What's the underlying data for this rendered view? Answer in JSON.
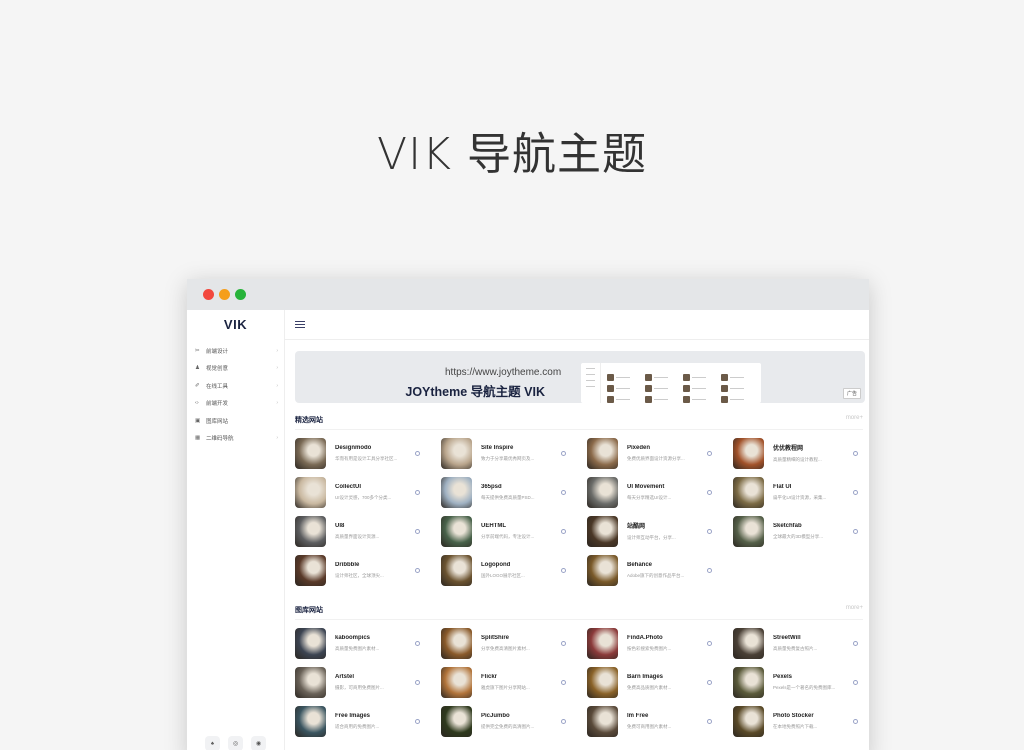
{
  "headline": "VIK 导航主题",
  "window": {
    "brand": "VIK",
    "sidebar": {
      "items": [
        {
          "icon": "✂",
          "icon_name": "scissors-icon",
          "label": "前端设计"
        },
        {
          "icon": "♟",
          "icon_name": "pin-icon",
          "label": "视觉创意"
        },
        {
          "icon": "✐",
          "icon_name": "pen-icon",
          "label": "在线工具"
        },
        {
          "icon": "‹›",
          "icon_name": "code-icon",
          "label": "前端开发"
        },
        {
          "icon": "▣",
          "icon_name": "image-icon",
          "label": "图库网站"
        },
        {
          "icon": "▦",
          "icon_name": "qrcode-icon",
          "label": "二维码导航"
        }
      ],
      "chevron": "›",
      "footer_buttons": [
        {
          "icon": "♠",
          "icon_name": "qq-icon"
        },
        {
          "icon": "◎",
          "icon_name": "weibo-icon"
        },
        {
          "icon": "◉",
          "icon_name": "wechat-icon"
        }
      ]
    },
    "banner": {
      "url": "https://www.joytheme.com",
      "title": "JOYtheme 导航主题 VIK",
      "ad_label": "广告"
    },
    "sections": [
      {
        "title": "精选网站",
        "more": "more+",
        "cards": [
          {
            "name": "Designmodo",
            "desc": "华而有用是设计工具分享社区...",
            "color": "#7a6a55"
          },
          {
            "name": "Site Inspire",
            "desc": "致力于分享最优秀网页及...",
            "color": "#b9a58c"
          },
          {
            "name": "Pixeden",
            "desc": "免费优质界面设计资源分享...",
            "color": "#8b6a4a"
          },
          {
            "name": "优优教程网",
            "desc": "高质量精细的设计教程...",
            "color": "#a2522a"
          },
          {
            "name": "CollectUI",
            "desc": "UI设计灵感，700多个分类...",
            "color": "#c9b8a0"
          },
          {
            "name": "365psd",
            "desc": "每天提供免费高质量PSD...",
            "color": "#9fb1c2"
          },
          {
            "name": "UI Movement",
            "desc": "每天分享精选UI设计...",
            "color": "#6b6c69"
          },
          {
            "name": "Flat UI",
            "desc": "扁平化UI设计资源，采集...",
            "color": "#7c6b45"
          },
          {
            "name": "UI8",
            "desc": "高质量界面设计资源...",
            "color": "#5d5e60"
          },
          {
            "name": "UEHTML",
            "desc": "分享前端代码，专注设计...",
            "color": "#48624a"
          },
          {
            "name": "站酷网",
            "desc": "设计师互动平台，分享...",
            "color": "#4a3726"
          },
          {
            "name": "Sketchfab",
            "desc": "全球最大的3D模型分享...",
            "color": "#556049"
          },
          {
            "name": "Dribbble",
            "desc": "设计师社区，全球顶尖...",
            "color": "#5a3a29"
          },
          {
            "name": "Logopond",
            "desc": "国外LOGO展示社区...",
            "color": "#6b5330"
          },
          {
            "name": "Behance",
            "desc": "Adobe旗下的创意作品平台...",
            "color": "#7a5a2a"
          }
        ]
      },
      {
        "title": "图库网站",
        "more": "more+",
        "cards": [
          {
            "name": "kaboompics",
            "desc": "高质量免费图片素材...",
            "color": "#3c4452"
          },
          {
            "name": "SplitShire",
            "desc": "分享免费高清图片素材...",
            "color": "#8a5a2a"
          },
          {
            "name": "FindA.Photo",
            "desc": "按色彩搜索免费图片...",
            "color": "#8b3a3a"
          },
          {
            "name": "StreetWill",
            "desc": "高质量免费复古照片...",
            "color": "#4a4036"
          },
          {
            "name": "Artstel",
            "desc": "摄影，可商用免费图片...",
            "color": "#6a6258"
          },
          {
            "name": "Flickr",
            "desc": "雅虎旗下图片分享网站...",
            "color": "#b2743a"
          },
          {
            "name": "Barn Images",
            "desc": "免费高品质图片素材...",
            "color": "#8a6228"
          },
          {
            "name": "Pexels",
            "desc": "Pexels是一个著名的免费图库...",
            "color": "#5a5a3a"
          },
          {
            "name": "Free Images",
            "desc": "适合商用的免费图片...",
            "color": "#3a5560"
          },
          {
            "name": "PicJumbo",
            "desc": "提供完全免费的高清图片...",
            "color": "#2f3a1e"
          },
          {
            "name": "Im Free",
            "desc": "免费可商用图片素材...",
            "color": "#5a4a3a"
          },
          {
            "name": "Photo Stocker",
            "desc": "在本地免费照片下载...",
            "color": "#5a4a28"
          }
        ]
      }
    ]
  }
}
